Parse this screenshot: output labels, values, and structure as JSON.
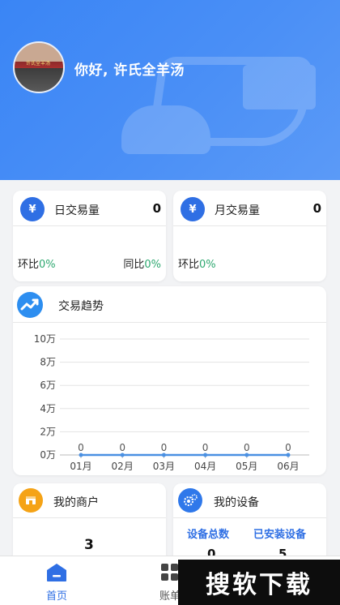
{
  "header": {
    "greeting": "你好, 许氏全羊汤",
    "avatar_sign_text": "许氏全羊汤"
  },
  "daily_card": {
    "icon": "money-bag-icon",
    "icon_symbol": "¥",
    "title": "日交易量",
    "value": "0",
    "mom_label": "环比",
    "mom_value": "0%",
    "yoy_label": "同比",
    "yoy_value": "0%"
  },
  "monthly_card": {
    "icon": "money-bag-icon",
    "icon_symbol": "¥",
    "title": "月交易量",
    "value": "0",
    "mom_label": "环比",
    "mom_value": "0%"
  },
  "trend_card": {
    "icon": "trend-up-icon",
    "title": "交易趋势"
  },
  "chart_data": {
    "type": "line",
    "categories": [
      "01月",
      "02月",
      "03月",
      "04月",
      "05月",
      "06月"
    ],
    "values": [
      0,
      0,
      0,
      0,
      0,
      0
    ],
    "data_labels": [
      "0",
      "0",
      "0",
      "0",
      "0",
      "0"
    ],
    "y_ticks": [
      "0万",
      "2万",
      "4万",
      "6万",
      "8万",
      "10万"
    ],
    "ylim": [
      0,
      10
    ],
    "grid": true,
    "series_color": "#4a90e2"
  },
  "merchant_card": {
    "icon": "shop-icon",
    "title": "我的商户",
    "value": "3"
  },
  "device_card": {
    "icon": "gear-icon",
    "title": "我的设备",
    "col1_label": "设备总数",
    "col2_label": "已安装设备",
    "col1_value": "0",
    "col2_value": "5"
  },
  "tabbar": {
    "tabs": [
      {
        "label": "首页",
        "icon": "home-icon",
        "active": true
      },
      {
        "label": "账单",
        "icon": "grid-icon",
        "active": false
      }
    ],
    "active_color": "#2f6fe4"
  },
  "watermark": "搜软下载",
  "colors": {
    "header_blue": "#3a85f5",
    "accent_blue": "#2f6fe4",
    "orange": "#f5a316",
    "positive_green": "#2ea870"
  }
}
